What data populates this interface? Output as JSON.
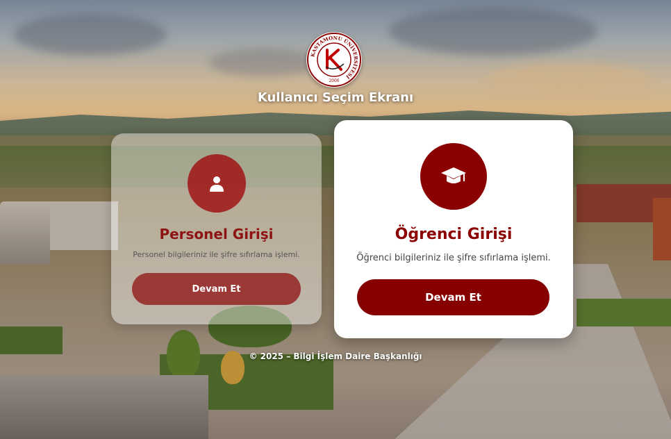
{
  "header": {
    "logo_ring_text": "KASTAMONU ÜNİVERSİTESİ",
    "logo_year": "2006",
    "screen_title": "Kullanıcı Seçim Ekranı"
  },
  "cards": {
    "staff": {
      "icon": "user-icon",
      "title": "Personel Girişi",
      "description": "Personel bilgileriniz ile şifre sıfırlama işlemi.",
      "button_label": "Devam Et"
    },
    "student": {
      "icon": "graduation-cap-icon",
      "title": "Öğrenci Girişi",
      "description": "Öğrenci bilgileriniz ile şifre sıfırlama işlemi.",
      "button_label": "Devam Et"
    }
  },
  "footer": {
    "text": "© 2025 – Bilgi İşlem Daire Başkanlığı"
  },
  "colors": {
    "brand": "#8b0000",
    "card_student_bg": "#ffffff",
    "text_white": "#ffffff"
  }
}
